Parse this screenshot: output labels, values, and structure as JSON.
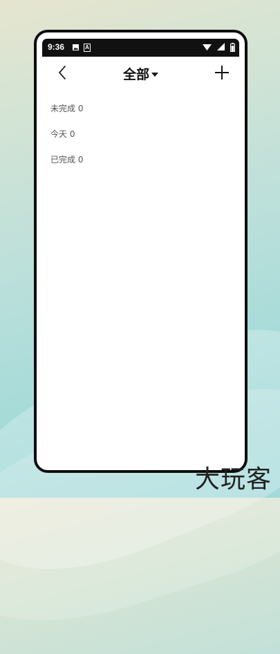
{
  "status_bar": {
    "time": "9:36",
    "notification_icons": [
      "image-icon",
      "a-icon"
    ],
    "a_glyph": "A",
    "right_icons": [
      "wifi-icon",
      "signal-icon",
      "battery-icon"
    ]
  },
  "app_bar": {
    "title": "全部",
    "back_icon": "chevron-left-icon",
    "dropdown_icon": "caret-down-icon",
    "add_icon": "plus-icon"
  },
  "list": {
    "items": [
      {
        "label": "未完成 0"
      },
      {
        "label": "今天 0"
      },
      {
        "label": "已完成 0"
      }
    ]
  },
  "watermark": "大玩客",
  "colors": {
    "frame": "#0c0c0c",
    "status_bar": "#111111",
    "background": "#ffffff",
    "item_text": "#555555"
  }
}
